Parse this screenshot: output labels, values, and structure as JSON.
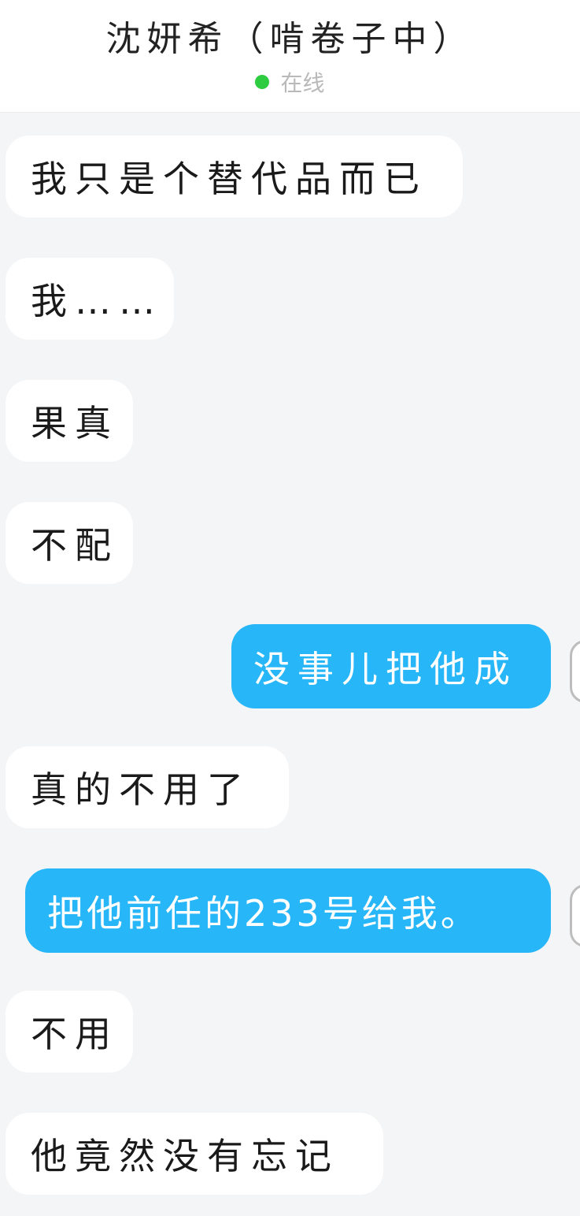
{
  "header": {
    "title": "沈妍希（啃卷子中）",
    "status": "在线",
    "status_color": "#2ecc40"
  },
  "messages": [
    {
      "side": "in",
      "text": "我只是个替代品而已"
    },
    {
      "side": "in",
      "text": "我……"
    },
    {
      "side": "in",
      "text": "果真"
    },
    {
      "side": "in",
      "text": "不配"
    },
    {
      "side": "out",
      "text": "没事儿把他成"
    },
    {
      "side": "in",
      "text": "真的不用了"
    },
    {
      "side": "out",
      "text": "把他前任的233号给我。"
    },
    {
      "side": "in",
      "text": "不用"
    },
    {
      "side": "in",
      "text": "他竟然没有忘记"
    }
  ],
  "colors": {
    "outgoing_bubble": "#27b6f8",
    "incoming_bubble": "#ffffff",
    "background": "#f4f5f7"
  }
}
